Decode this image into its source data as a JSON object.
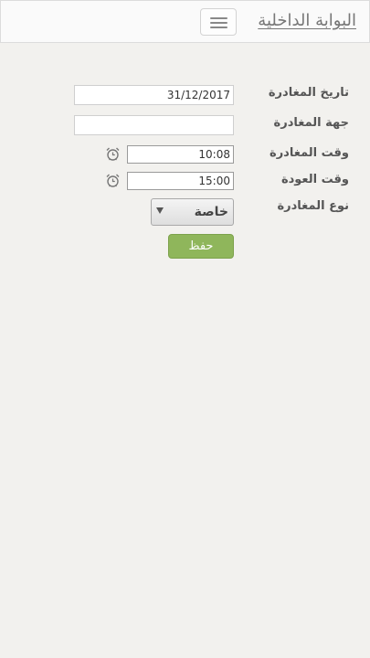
{
  "header": {
    "brand": "البوابة الداخلية",
    "menu_icon": "hamburger-menu-icon"
  },
  "form": {
    "departure_date": {
      "label": "تاريخ المغادرة",
      "value": "31/12/2017"
    },
    "destination": {
      "label": "جهة المغادرة",
      "value": ""
    },
    "departure_time": {
      "label": "وقت المغادرة",
      "value": "10:08",
      "icon": "alarm-clock-icon"
    },
    "return_time": {
      "label": "وقت العودة",
      "value": "15:00",
      "icon": "alarm-clock-icon"
    },
    "departure_type": {
      "label": "نوع المغادرة",
      "selected": "خاصة"
    },
    "save_label": "حفظ"
  },
  "colors": {
    "save_button": "#8fb65b",
    "background": "#f2f1ee"
  }
}
